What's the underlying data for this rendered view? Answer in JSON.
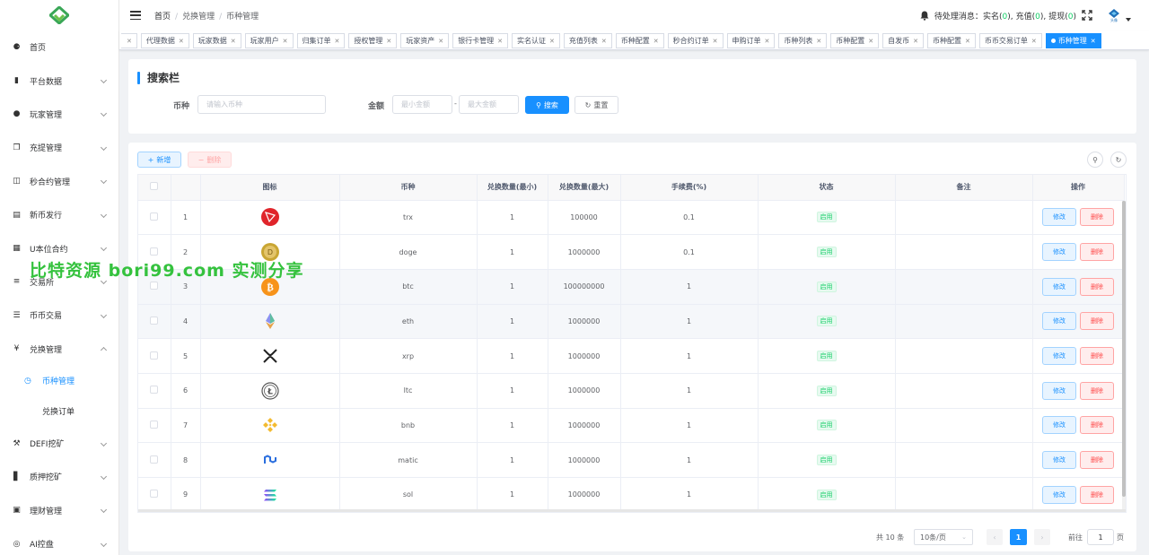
{
  "navbar": {
    "breadcrumb": [
      "首页",
      "兑换管理",
      "币种管理"
    ],
    "pending_label": "待处理消息：",
    "pending_items": [
      {
        "label": "实名",
        "count": "0"
      },
      {
        "label": "充值",
        "count": "0"
      },
      {
        "label": "提现",
        "count": "0"
      }
    ],
    "avatar_text": "头像",
    "colors": {
      "accent": "#1890ff",
      "success": "#13ce66",
      "danger": "#ff4949"
    }
  },
  "sidebar": {
    "items": [
      {
        "label": "首页",
        "icon": "dashboard-icon",
        "expandable": false
      },
      {
        "label": "平台数据",
        "icon": "chart-icon",
        "expandable": true
      },
      {
        "label": "玩家管理",
        "icon": "user-icon",
        "expandable": true
      },
      {
        "label": "充提管理",
        "icon": "copy-icon",
        "expandable": true
      },
      {
        "label": "秒合约管理",
        "icon": "monitor-icon",
        "expandable": true
      },
      {
        "label": "新币发行",
        "icon": "card-icon",
        "expandable": true
      },
      {
        "label": "U本位合约",
        "icon": "grid-icon",
        "expandable": true
      },
      {
        "label": "交易所",
        "icon": "list-icon",
        "expandable": true
      },
      {
        "label": "币币交易",
        "icon": "menu-icon",
        "expandable": true
      },
      {
        "label": "兑换管理",
        "icon": "yen-icon",
        "expandable": true,
        "open": true
      },
      {
        "label": "DEFI挖矿",
        "icon": "worker-icon",
        "expandable": true
      },
      {
        "label": "质押挖矿",
        "icon": "bars-icon",
        "expandable": true
      },
      {
        "label": "理财管理",
        "icon": "doc-icon",
        "expandable": true
      },
      {
        "label": "AI控盘",
        "icon": "robot-icon",
        "expandable": true
      }
    ],
    "sub_items": [
      {
        "label": "币种管理",
        "active": true
      },
      {
        "label": "兑换订单",
        "active": false
      }
    ]
  },
  "tags": [
    {
      "label": ""
    },
    {
      "label": "代理数据"
    },
    {
      "label": "玩家数据"
    },
    {
      "label": "玩家用户"
    },
    {
      "label": "归集订单"
    },
    {
      "label": "授权管理"
    },
    {
      "label": "玩家资产"
    },
    {
      "label": "银行卡管理"
    },
    {
      "label": "实名认证"
    },
    {
      "label": "充值列表"
    },
    {
      "label": "币种配置"
    },
    {
      "label": "秒合约订单"
    },
    {
      "label": "申购订单"
    },
    {
      "label": "币种列表"
    },
    {
      "label": "币种配置"
    },
    {
      "label": "自发币"
    },
    {
      "label": "币种配置"
    },
    {
      "label": "币币交易订单"
    },
    {
      "label": "币种管理",
      "active": true
    }
  ],
  "search": {
    "title": "搜索栏",
    "coin_label": "币种",
    "coin_placeholder": "请输入币种",
    "amount_label": "金额",
    "min_placeholder": "最小金额",
    "max_placeholder": "最大金额",
    "dash": "-",
    "search_btn": "搜索",
    "reset_btn": "重置"
  },
  "toolbar": {
    "add_btn": "新增",
    "delete_btn": "删除"
  },
  "table": {
    "columns": [
      "图标",
      "币种",
      "兑换数量(最小)",
      "兑换数量(最大)",
      "手续费(%)",
      "状态",
      "备注",
      "操作"
    ],
    "rows": [
      {
        "idx": "1",
        "icon": "trx-icon",
        "coin": "trx",
        "min": "1",
        "max": "100000",
        "fee": "0.1",
        "status": "启用",
        "remark": ""
      },
      {
        "idx": "2",
        "icon": "doge-icon",
        "coin": "doge",
        "min": "1",
        "max": "1000000",
        "fee": "0.1",
        "status": "启用",
        "remark": ""
      },
      {
        "idx": "3",
        "icon": "btc-icon",
        "coin": "btc",
        "min": "1",
        "max": "100000000",
        "fee": "1",
        "status": "启用",
        "remark": ""
      },
      {
        "idx": "4",
        "icon": "eth-icon",
        "coin": "eth",
        "min": "1",
        "max": "1000000",
        "fee": "1",
        "status": "启用",
        "remark": ""
      },
      {
        "idx": "5",
        "icon": "xrp-icon",
        "coin": "xrp",
        "min": "1",
        "max": "1000000",
        "fee": "1",
        "status": "启用",
        "remark": ""
      },
      {
        "idx": "6",
        "icon": "ltc-icon",
        "coin": "ltc",
        "min": "1",
        "max": "1000000",
        "fee": "1",
        "status": "启用",
        "remark": ""
      },
      {
        "idx": "7",
        "icon": "bnb-icon",
        "coin": "bnb",
        "min": "1",
        "max": "1000000",
        "fee": "1",
        "status": "启用",
        "remark": ""
      },
      {
        "idx": "8",
        "icon": "matic-icon",
        "coin": "matic",
        "min": "1",
        "max": "1000000",
        "fee": "1",
        "status": "启用",
        "remark": ""
      },
      {
        "idx": "9",
        "icon": "sol-icon",
        "coin": "sol",
        "min": "1",
        "max": "1000000",
        "fee": "1",
        "status": "启用",
        "remark": ""
      }
    ],
    "edit_label": "修改",
    "delete_label": "删除"
  },
  "pagination": {
    "total_text": "共 10 条",
    "page_size": "10条/页",
    "current": "1",
    "goto_label": "前往",
    "goto_value": "1",
    "page_unit": "页",
    "prev": "‹",
    "next": "›"
  },
  "watermark": "比特资源 bori99.com 实测分享"
}
